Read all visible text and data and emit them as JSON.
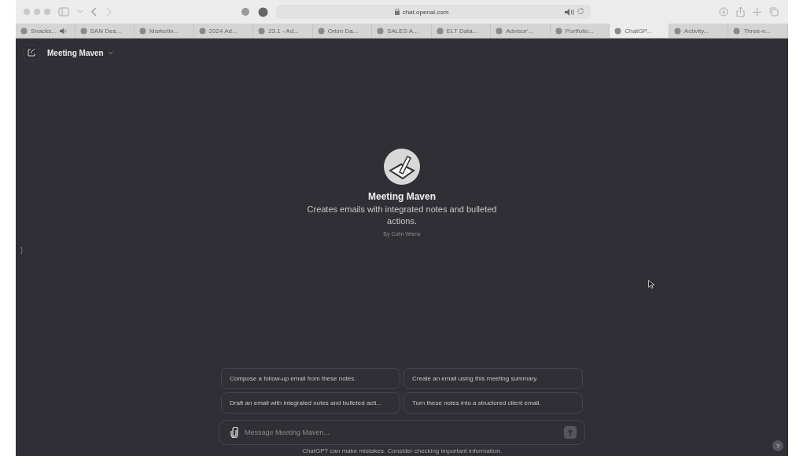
{
  "browser": {
    "address": "chat.openai.com",
    "tabs": [
      {
        "label": "Snacks...",
        "selected": false,
        "audio": true
      },
      {
        "label": "SAN Des...",
        "selected": false,
        "audio": false
      },
      {
        "label": "Marketin...",
        "selected": false,
        "audio": false
      },
      {
        "label": "2024 Ad...",
        "selected": false,
        "audio": false
      },
      {
        "label": "23.1 - Ad...",
        "selected": false,
        "audio": false
      },
      {
        "label": "Orion Da...",
        "selected": false,
        "audio": false
      },
      {
        "label": "SALES A...",
        "selected": false,
        "audio": false
      },
      {
        "label": "ELT Data...",
        "selected": false,
        "audio": false
      },
      {
        "label": "Advisor'...",
        "selected": false,
        "audio": false
      },
      {
        "label": "Portfolio...",
        "selected": false,
        "audio": false
      },
      {
        "label": "ChatGP...",
        "selected": true,
        "audio": false
      },
      {
        "label": "Activity...",
        "selected": false,
        "audio": false
      },
      {
        "label": "Three-n...",
        "selected": false,
        "audio": false
      }
    ]
  },
  "header": {
    "title": "Meeting Maven"
  },
  "gpt": {
    "name": "Meeting Maven",
    "description": "Creates emails with integrated notes and bulleted actions.",
    "author": "By Colin Wiens"
  },
  "suggestions": [
    "Compose a follow-up email from these notes.",
    "Create an email using this meeting summary.",
    "Draft an email with integrated notes and bulleted acti...",
    "Turn these notes into a structured client email."
  ],
  "composer": {
    "placeholder": "Message Meeting Maven..."
  },
  "disclaimer": "ChatGPT can make mistakes. Consider checking important information.",
  "help": "?",
  "sidebar_toggle": "}"
}
